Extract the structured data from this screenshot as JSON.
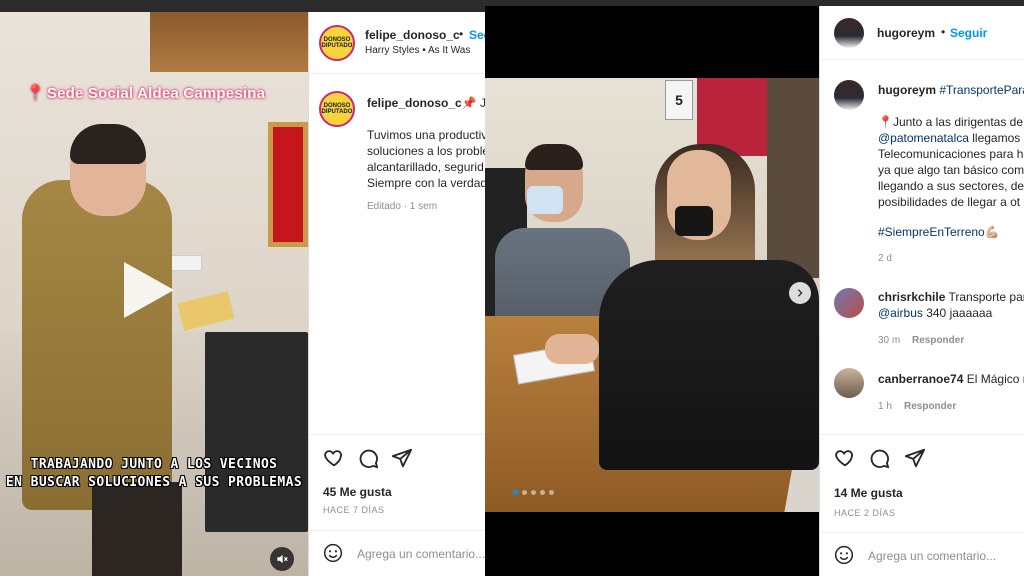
{
  "post_left": {
    "video": {
      "location_label": "Sede Social Aldea Campesina",
      "caption_line1": "TRABAJANDO JUNTO A LOS VECINOS",
      "caption_line2": "EN BUSCAR SOLUCIONES A SUS PROBLEMAS"
    },
    "author": {
      "avatar_text": "DONOSO DIPUTADO",
      "username": "felipe_donoso_c",
      "follow_label": "Seguir",
      "audio": "Harry Styles • As It Was"
    },
    "caption": {
      "username": "felipe_donoso_c",
      "lead": "📌 JU",
      "lines": [
        "Tuvimos una productiv",
        "soluciones a los proble",
        "alcantarillado, segurid",
        "Siempre con la verdad"
      ],
      "meta": "Editado · 1 sem"
    },
    "likes": "45 Me gusta",
    "ago": "HACE 7 DÍAS",
    "comment_placeholder": "Agrega un comentario..."
  },
  "post_right": {
    "author": {
      "username": "hugoreym",
      "follow_label": "Seguir"
    },
    "caption": {
      "username": "hugoreym",
      "hashtag_lead": "#TransportePara",
      "line1": "📍Junto a las dirigentas de",
      "mention": "@patomenatalca",
      "line2_rest": " llegamos",
      "line3": "Telecomunicaciones para h",
      "line4": "ya que algo tan básico com",
      "line5": "llegando a sus sectores, de",
      "line6": "posibilidades de llegar a ot",
      "hashtag": "#SiempreEnTerreno💪🏼",
      "ago": "2 d"
    },
    "comments": [
      {
        "username": "chrisrkchile",
        "text": " Transporte par",
        "line2_mention": "@airbus",
        "line2_text": " 340 jaaaaaa",
        "ago": "30 m",
        "reply": "Responder"
      },
      {
        "username": "canberranoe74",
        "text": " El Mágico n",
        "ago": "1 h",
        "reply": "Responder"
      }
    ],
    "likes": "14 Me gusta",
    "ago": "HACE 2 DÍAS",
    "comment_placeholder": "Agrega un comentario..."
  },
  "photo_mid": {
    "sign_number": "5",
    "carousel_index": 1,
    "carousel_count": 5
  },
  "colors": {
    "link_blue": "#0095f6",
    "mention_blue": "#00376b",
    "muted_gray": "#8e8e8e",
    "text": "#262626"
  }
}
